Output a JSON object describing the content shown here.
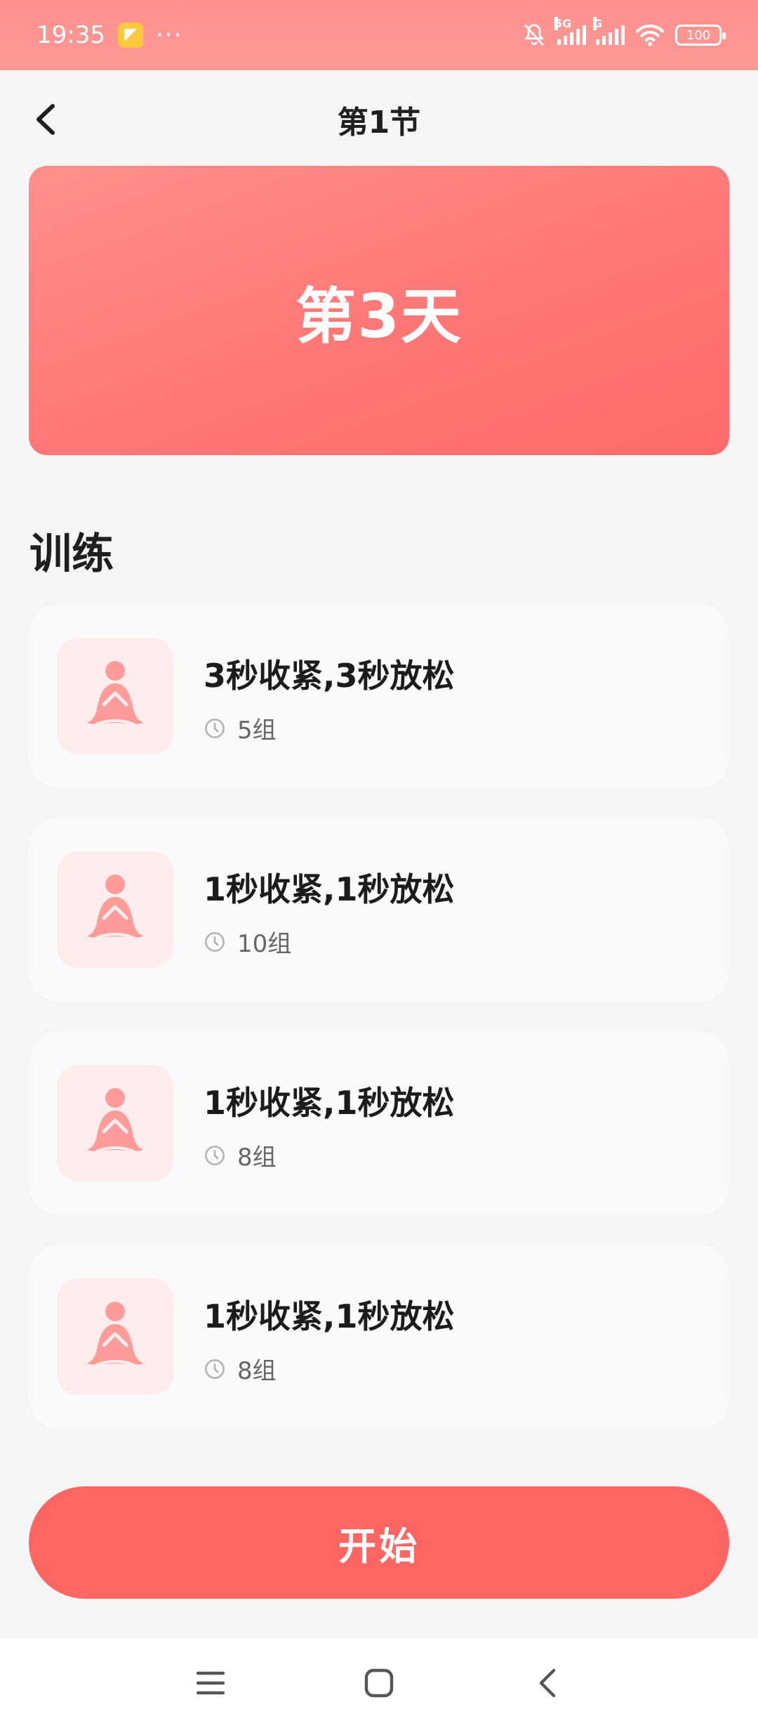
{
  "status_bar": {
    "time": "19:35",
    "more": "···",
    "signal1_label": "5G",
    "signal2_label": "G",
    "battery": "100"
  },
  "header": {
    "title": "第1节"
  },
  "hero": {
    "title": "第3天"
  },
  "section": {
    "title": "训练"
  },
  "exercises": [
    {
      "title": "3秒收紧,3秒放松",
      "sets": "5组"
    },
    {
      "title": "1秒收紧,1秒放松",
      "sets": "10组"
    },
    {
      "title": "1秒收紧,1秒放松",
      "sets": "8组"
    },
    {
      "title": "1秒收紧,1秒放松",
      "sets": "8组"
    }
  ],
  "actions": {
    "start_label": "开始"
  },
  "colors": {
    "accent": "#ff6563",
    "hero_start": "#ff8f8c",
    "thumb_bg": "#ffeded"
  }
}
